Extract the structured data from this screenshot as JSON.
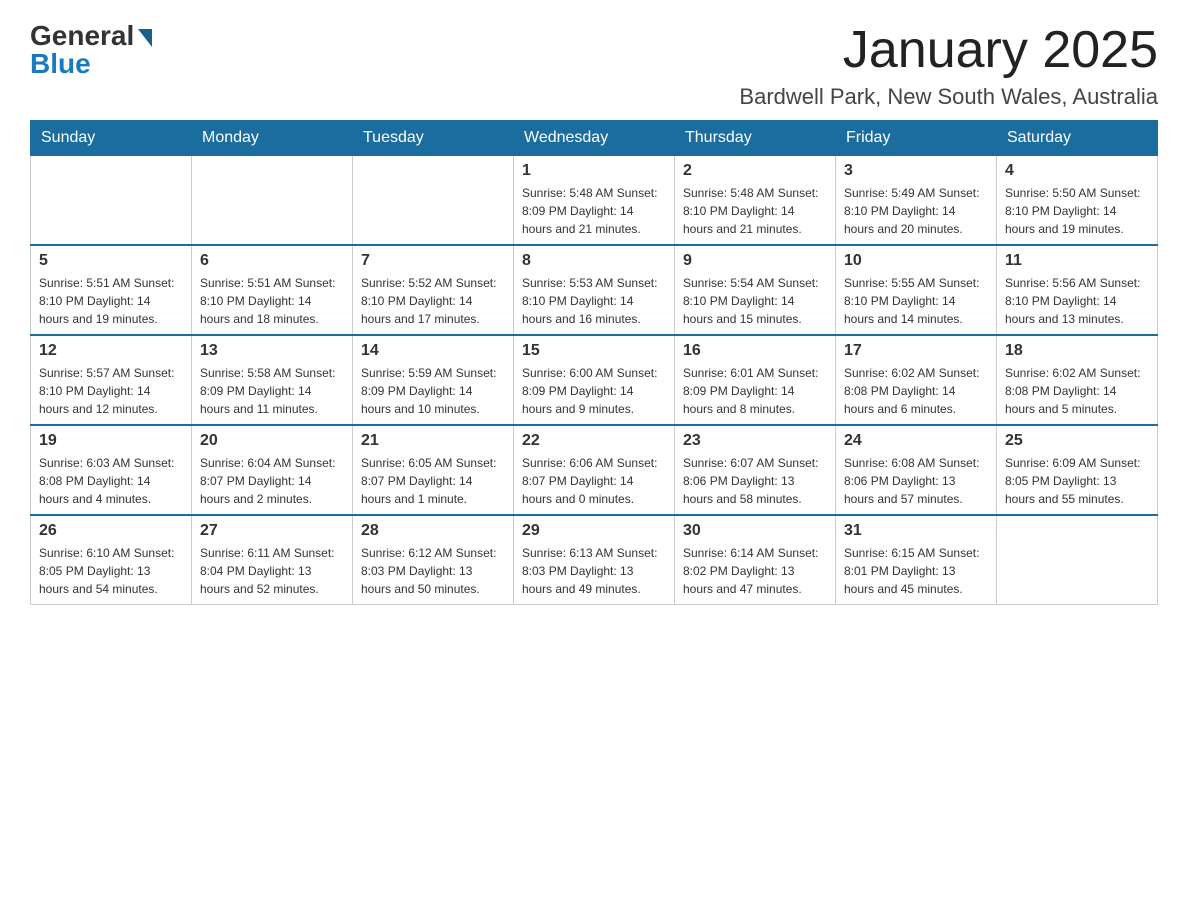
{
  "logo": {
    "general": "General",
    "blue": "Blue"
  },
  "title": "January 2025",
  "location": "Bardwell Park, New South Wales, Australia",
  "days_of_week": [
    "Sunday",
    "Monday",
    "Tuesday",
    "Wednesday",
    "Thursday",
    "Friday",
    "Saturday"
  ],
  "weeks": [
    [
      {
        "day": "",
        "info": ""
      },
      {
        "day": "",
        "info": ""
      },
      {
        "day": "",
        "info": ""
      },
      {
        "day": "1",
        "info": "Sunrise: 5:48 AM\nSunset: 8:09 PM\nDaylight: 14 hours\nand 21 minutes."
      },
      {
        "day": "2",
        "info": "Sunrise: 5:48 AM\nSunset: 8:10 PM\nDaylight: 14 hours\nand 21 minutes."
      },
      {
        "day": "3",
        "info": "Sunrise: 5:49 AM\nSunset: 8:10 PM\nDaylight: 14 hours\nand 20 minutes."
      },
      {
        "day": "4",
        "info": "Sunrise: 5:50 AM\nSunset: 8:10 PM\nDaylight: 14 hours\nand 19 minutes."
      }
    ],
    [
      {
        "day": "5",
        "info": "Sunrise: 5:51 AM\nSunset: 8:10 PM\nDaylight: 14 hours\nand 19 minutes."
      },
      {
        "day": "6",
        "info": "Sunrise: 5:51 AM\nSunset: 8:10 PM\nDaylight: 14 hours\nand 18 minutes."
      },
      {
        "day": "7",
        "info": "Sunrise: 5:52 AM\nSunset: 8:10 PM\nDaylight: 14 hours\nand 17 minutes."
      },
      {
        "day": "8",
        "info": "Sunrise: 5:53 AM\nSunset: 8:10 PM\nDaylight: 14 hours\nand 16 minutes."
      },
      {
        "day": "9",
        "info": "Sunrise: 5:54 AM\nSunset: 8:10 PM\nDaylight: 14 hours\nand 15 minutes."
      },
      {
        "day": "10",
        "info": "Sunrise: 5:55 AM\nSunset: 8:10 PM\nDaylight: 14 hours\nand 14 minutes."
      },
      {
        "day": "11",
        "info": "Sunrise: 5:56 AM\nSunset: 8:10 PM\nDaylight: 14 hours\nand 13 minutes."
      }
    ],
    [
      {
        "day": "12",
        "info": "Sunrise: 5:57 AM\nSunset: 8:10 PM\nDaylight: 14 hours\nand 12 minutes."
      },
      {
        "day": "13",
        "info": "Sunrise: 5:58 AM\nSunset: 8:09 PM\nDaylight: 14 hours\nand 11 minutes."
      },
      {
        "day": "14",
        "info": "Sunrise: 5:59 AM\nSunset: 8:09 PM\nDaylight: 14 hours\nand 10 minutes."
      },
      {
        "day": "15",
        "info": "Sunrise: 6:00 AM\nSunset: 8:09 PM\nDaylight: 14 hours\nand 9 minutes."
      },
      {
        "day": "16",
        "info": "Sunrise: 6:01 AM\nSunset: 8:09 PM\nDaylight: 14 hours\nand 8 minutes."
      },
      {
        "day": "17",
        "info": "Sunrise: 6:02 AM\nSunset: 8:08 PM\nDaylight: 14 hours\nand 6 minutes."
      },
      {
        "day": "18",
        "info": "Sunrise: 6:02 AM\nSunset: 8:08 PM\nDaylight: 14 hours\nand 5 minutes."
      }
    ],
    [
      {
        "day": "19",
        "info": "Sunrise: 6:03 AM\nSunset: 8:08 PM\nDaylight: 14 hours\nand 4 minutes."
      },
      {
        "day": "20",
        "info": "Sunrise: 6:04 AM\nSunset: 8:07 PM\nDaylight: 14 hours\nand 2 minutes."
      },
      {
        "day": "21",
        "info": "Sunrise: 6:05 AM\nSunset: 8:07 PM\nDaylight: 14 hours\nand 1 minute."
      },
      {
        "day": "22",
        "info": "Sunrise: 6:06 AM\nSunset: 8:07 PM\nDaylight: 14 hours\nand 0 minutes."
      },
      {
        "day": "23",
        "info": "Sunrise: 6:07 AM\nSunset: 8:06 PM\nDaylight: 13 hours\nand 58 minutes."
      },
      {
        "day": "24",
        "info": "Sunrise: 6:08 AM\nSunset: 8:06 PM\nDaylight: 13 hours\nand 57 minutes."
      },
      {
        "day": "25",
        "info": "Sunrise: 6:09 AM\nSunset: 8:05 PM\nDaylight: 13 hours\nand 55 minutes."
      }
    ],
    [
      {
        "day": "26",
        "info": "Sunrise: 6:10 AM\nSunset: 8:05 PM\nDaylight: 13 hours\nand 54 minutes."
      },
      {
        "day": "27",
        "info": "Sunrise: 6:11 AM\nSunset: 8:04 PM\nDaylight: 13 hours\nand 52 minutes."
      },
      {
        "day": "28",
        "info": "Sunrise: 6:12 AM\nSunset: 8:03 PM\nDaylight: 13 hours\nand 50 minutes."
      },
      {
        "day": "29",
        "info": "Sunrise: 6:13 AM\nSunset: 8:03 PM\nDaylight: 13 hours\nand 49 minutes."
      },
      {
        "day": "30",
        "info": "Sunrise: 6:14 AM\nSunset: 8:02 PM\nDaylight: 13 hours\nand 47 minutes."
      },
      {
        "day": "31",
        "info": "Sunrise: 6:15 AM\nSunset: 8:01 PM\nDaylight: 13 hours\nand 45 minutes."
      },
      {
        "day": "",
        "info": ""
      }
    ]
  ]
}
